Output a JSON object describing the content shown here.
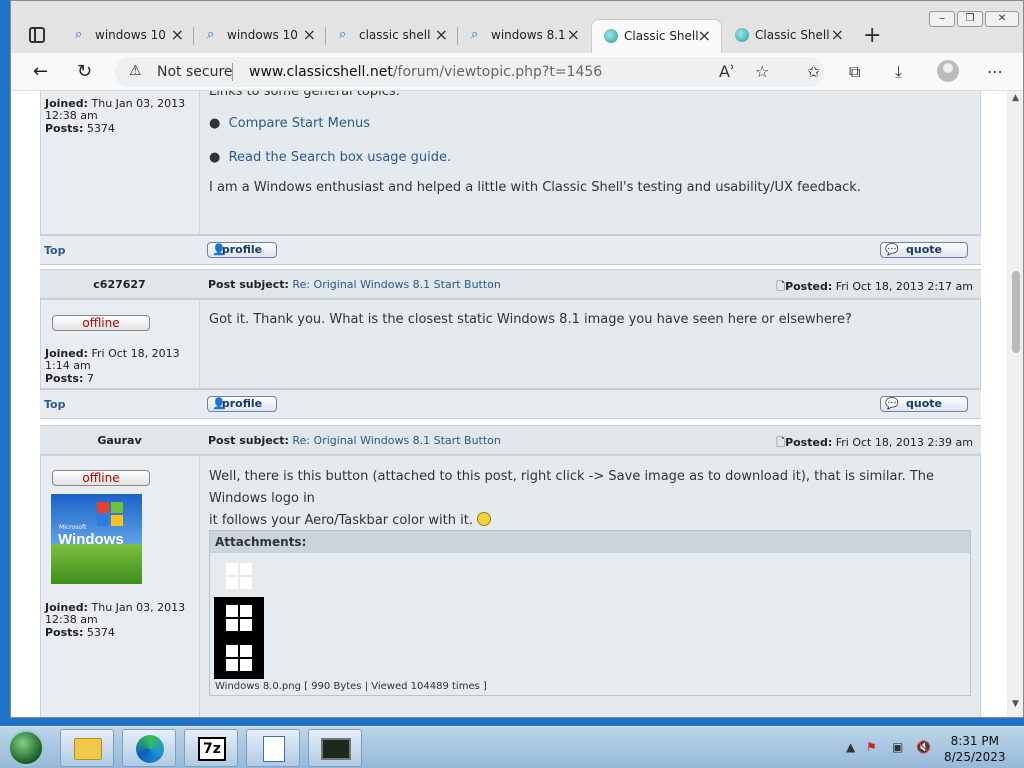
{
  "tabs": [
    {
      "label": "windows 10",
      "icon": "search-icon"
    },
    {
      "label": "windows 10",
      "icon": "search-icon"
    },
    {
      "label": "classic shell",
      "icon": "search-icon"
    },
    {
      "label": "windows 8.1",
      "icon": "search-icon"
    },
    {
      "label": "Classic Shell",
      "icon": "classic-shell-icon",
      "active": true
    },
    {
      "label": "Classic Shell",
      "icon": "classic-shell-icon"
    }
  ],
  "address": {
    "security": "Not secure",
    "url_host": "www.classicshell.net",
    "url_path": "/forum/viewtopic.php?t=1456"
  },
  "post1": {
    "joined_label": "Joined:",
    "joined": "Thu Jan 03, 2013 12:38 am",
    "posts_label": "Posts:",
    "posts": "5374",
    "intro": "Links to some general topics:",
    "links": [
      "Compare Start Menus",
      "Read the Search box usage guide."
    ],
    "text": "I am a Windows enthusiast and helped a little with Classic Shell's testing and usability/UX feedback.",
    "top": "Top",
    "profile": "profile",
    "quote": "quote"
  },
  "post2": {
    "author": "c627627",
    "subject_label": "Post subject:",
    "subject": "Re: Original Windows 8.1 Start Button",
    "posted_label": "Posted:",
    "posted": "Fri Oct 18, 2013 2:17 am",
    "status": "offline",
    "joined_label": "Joined:",
    "joined": "Fri Oct 18, 2013 1:14 am",
    "posts_label": "Posts:",
    "posts": "7",
    "text": "Got it. Thank you. What is the closest static Windows 8.1 image you have seen here or elsewhere?",
    "top": "Top",
    "profile": "profile",
    "quote": "quote"
  },
  "post3": {
    "author": "Gaurav",
    "subject_label": "Post subject:",
    "subject": "Re: Original Windows 8.1 Start Button",
    "posted_label": "Posted:",
    "posted": "Fri Oct 18, 2013 2:39 am",
    "status": "offline",
    "avatar_text": "Windows",
    "avatar_small": "Microsoft",
    "joined_label": "Joined:",
    "joined": "Thu Jan 03, 2013 12:38 am",
    "posts_label": "Posts:",
    "posts": "5374",
    "text_line1": "Well, there is this button (attached to this post, right click -> Save image as to download it), that is similar. The Windows logo in",
    "text_line2": "it follows your Aero/Taskbar color with it.",
    "attachments_label": "Attachments:",
    "attachment_caption": "Windows 8.0.png [ 990 Bytes | Viewed 104489 times ]"
  },
  "clock": {
    "time": "8:31 PM",
    "date": "8/25/2023"
  },
  "colors": {
    "link": "#2a5a8c",
    "offline": "#bb0000",
    "desktop": "#1e73c8"
  }
}
